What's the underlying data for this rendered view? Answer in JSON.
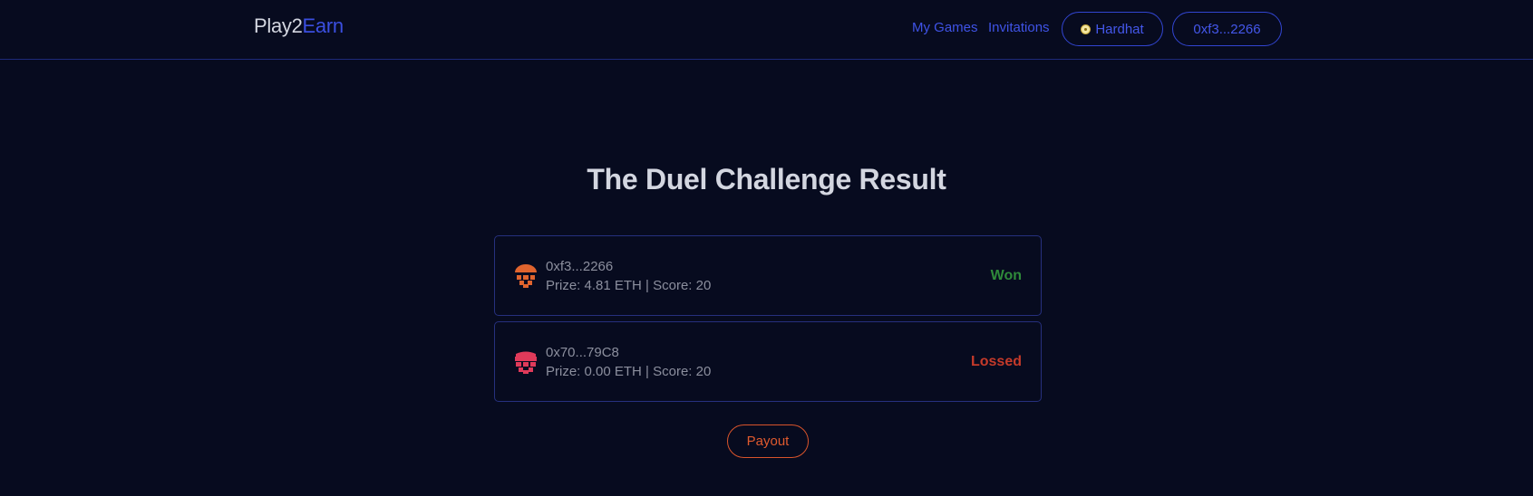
{
  "header": {
    "logo_part1": "Play2",
    "logo_part2": "Earn",
    "nav": {
      "my_games": "My Games",
      "invitations": "Invitations"
    },
    "network_label": "Hardhat",
    "account_label": "0xf3...2266"
  },
  "main": {
    "title": "The Duel Challenge Result",
    "players": [
      {
        "address": "0xf3...2266",
        "details": "Prize: 4.81 ETH | Score: 20",
        "result": "Won",
        "avatar_color": "#e0642e"
      },
      {
        "address": "0x70...79C8",
        "details": "Prize: 0.00 ETH | Score: 20",
        "result": "Lossed",
        "avatar_color": "#e03a5a"
      }
    ],
    "payout_label": "Payout"
  },
  "colors": {
    "background": "#070b1f",
    "accent": "#3b4fe0",
    "won": "#2f8a3a",
    "lost": "#c53a2a",
    "payout": "#e05a2e"
  }
}
